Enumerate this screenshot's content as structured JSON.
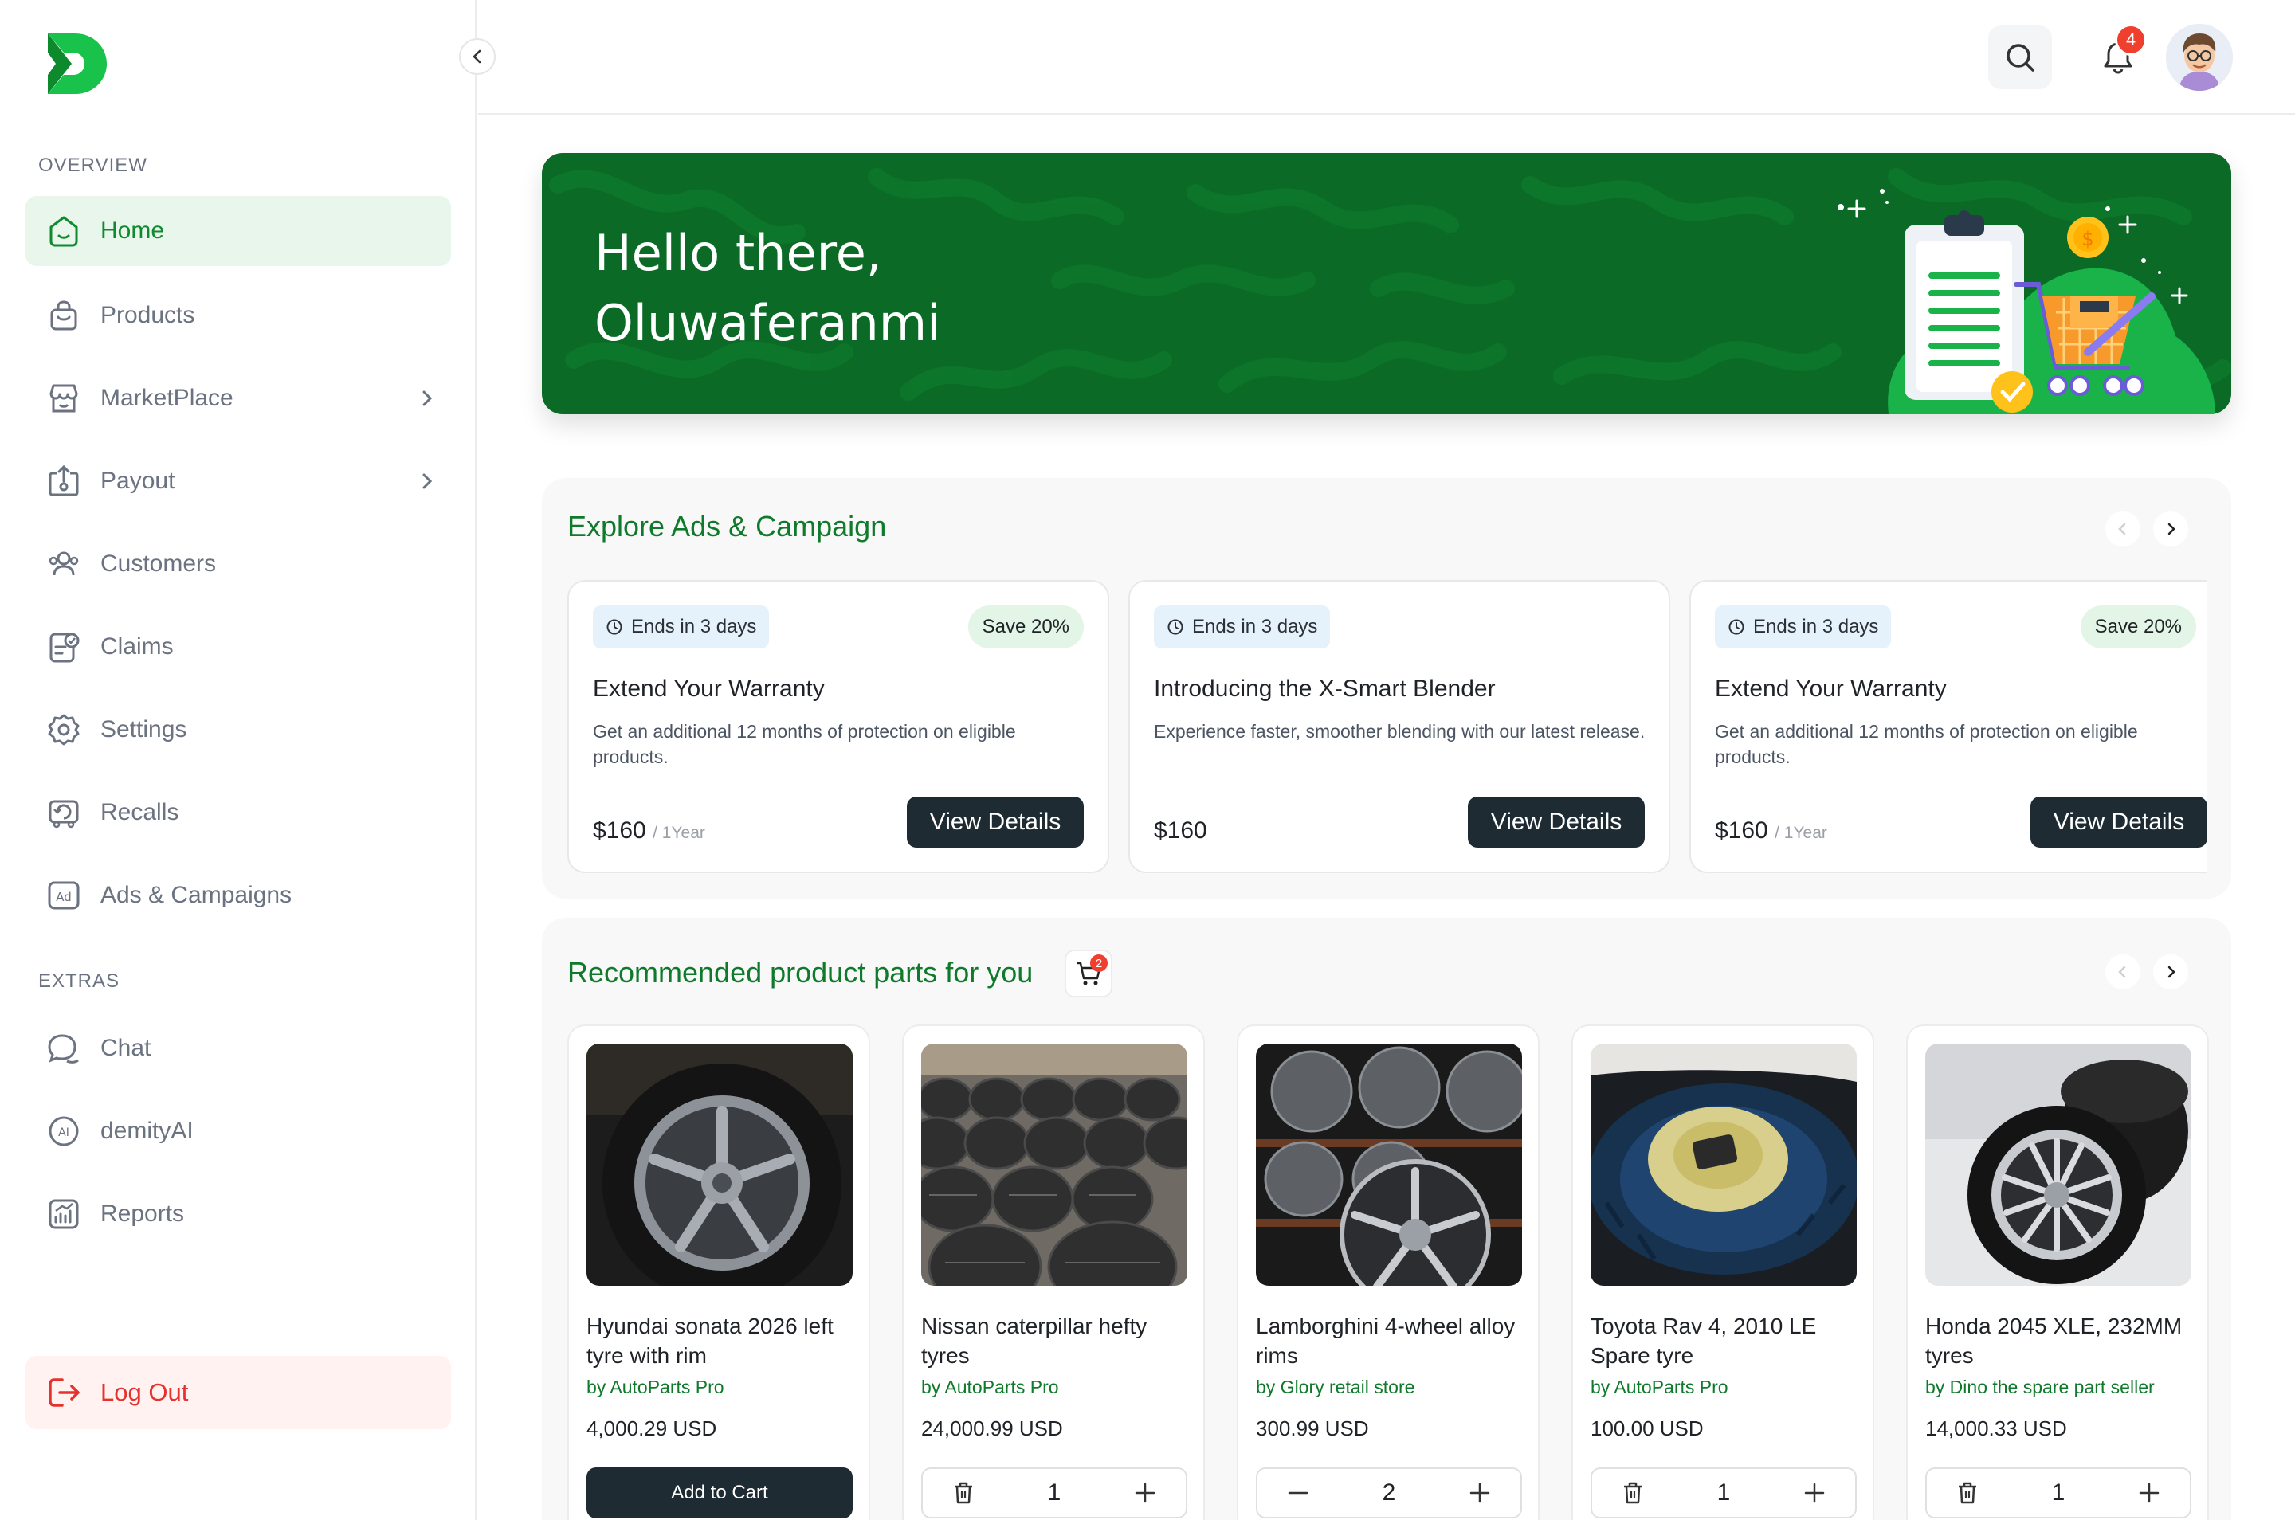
{
  "sidebar": {
    "overview_label": "OVERVIEW",
    "extras_label": "EXTRAS",
    "items": [
      {
        "label": "Home",
        "icon": "home-icon"
      },
      {
        "label": "Products",
        "icon": "bag-icon"
      },
      {
        "label": "MarketPlace",
        "icon": "store-icon"
      },
      {
        "label": "Payout",
        "icon": "payout-icon"
      },
      {
        "label": "Customers",
        "icon": "users-icon"
      },
      {
        "label": "Claims",
        "icon": "claims-icon"
      },
      {
        "label": "Settings",
        "icon": "gear-icon"
      },
      {
        "label": "Recalls",
        "icon": "recall-icon"
      },
      {
        "label": "Ads & Campaigns",
        "icon": "ad-icon"
      }
    ],
    "extras": [
      {
        "label": "Chat",
        "icon": "chat-icon"
      },
      {
        "label": "demityAI",
        "icon": "ai-icon"
      },
      {
        "label": "Reports",
        "icon": "reports-icon"
      }
    ],
    "logout_label": "Log Out"
  },
  "header": {
    "notification_count": "4"
  },
  "hero": {
    "line1": "Hello there,",
    "line2": "Oluwaferanmi"
  },
  "ads": {
    "title": "Explore Ads & Campaign",
    "cards": [
      {
        "ends": "Ends in 3 days",
        "save": "Save 20%",
        "title": "Extend Your Warranty",
        "desc": "Get an additional 12 months of protection on eligible products.",
        "price": "$160",
        "per": "/ 1Year",
        "button": "View Details"
      },
      {
        "ends": "Ends in 3 days",
        "save": "",
        "title": "Introducing the X-Smart Blender",
        "desc": "Experience faster, smoother blending with our latest release.",
        "price": "$160",
        "per": "",
        "button": "View Details"
      },
      {
        "ends": "Ends in 3 days",
        "save": "Save 20%",
        "title": "Extend Your Warranty",
        "desc": "Get an additional 12 months of protection on eligible products.",
        "price": "$160",
        "per": "/ 1Year",
        "button": "View Details"
      }
    ]
  },
  "recommended": {
    "title": "Recommended product parts for you",
    "cart_count": "2",
    "products": [
      {
        "name": "Hyundai sonata 2026 left tyre with rim",
        "seller": "by AutoParts Pro",
        "price": "4,000.29 USD",
        "button": "Add to Cart",
        "qty": ""
      },
      {
        "name": "Nissan caterpillar hefty tyres",
        "seller": "by AutoParts Pro",
        "price": "24,000.99 USD",
        "button": "",
        "qty": "1"
      },
      {
        "name": "Lamborghini 4-wheel alloy rims",
        "seller": "by Glory retail store",
        "price": "300.99 USD",
        "button": "",
        "qty": "2"
      },
      {
        "name": "Toyota Rav 4, 2010 LE Spare tyre",
        "seller": "by AutoParts Pro",
        "price": "100.00 USD",
        "button": "",
        "qty": "1"
      },
      {
        "name": "Honda 2045 XLE, 232MM tyres",
        "seller": "by Dino the spare part seller",
        "price": "14,000.33 USD",
        "button": "",
        "qty": "1"
      }
    ]
  },
  "colors": {
    "brand_green": "#0f8a2e",
    "hero_green": "#0b6b26",
    "danger": "#e5322d",
    "dark_button": "#1e2b33"
  }
}
